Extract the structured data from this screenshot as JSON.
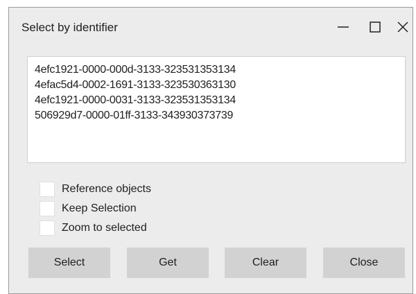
{
  "window": {
    "title": "Select by identifier",
    "controls": {
      "minimize_icon": "minimize-icon",
      "maximize_icon": "maximize-icon",
      "close_icon": "close-icon"
    }
  },
  "identifiers": {
    "lines": [
      "4efc1921-0000-000d-3133-323531353134",
      "4efac5d4-0002-1691-3133-323530363130",
      "4efc1921-0000-0031-3133-323531353134",
      "506929d7-0000-01ff-3133-343930373739"
    ]
  },
  "options": {
    "items": [
      {
        "label": "Reference objects",
        "checked": false
      },
      {
        "label": "Keep Selection",
        "checked": false
      },
      {
        "label": "Zoom to selected",
        "checked": false
      }
    ]
  },
  "buttons": {
    "select_label": "Select",
    "get_label": "Get",
    "clear_label": "Clear",
    "close_label": "Close"
  },
  "colors": {
    "dialog_bg": "#ececec",
    "button_bg": "#d2d2d2",
    "text": "#202020"
  }
}
